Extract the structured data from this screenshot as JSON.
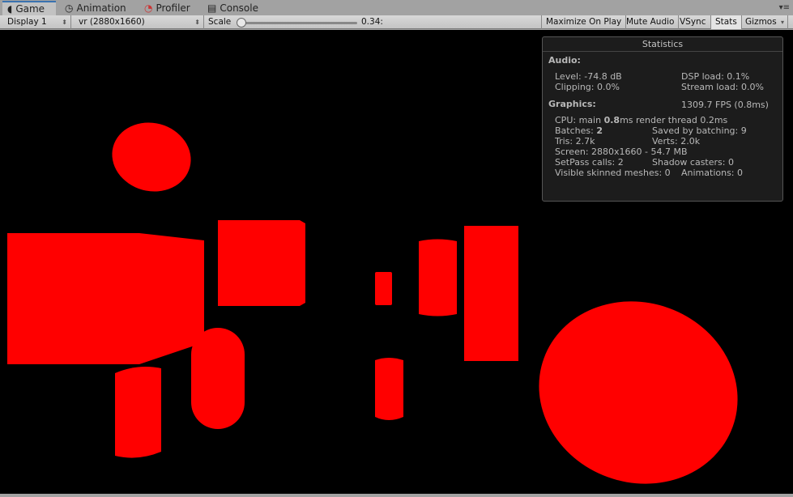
{
  "tabs": [
    {
      "label": "Game",
      "icon": "pacman-icon"
    },
    {
      "label": "Animation",
      "icon": "clock-icon"
    },
    {
      "label": "Profiler",
      "icon": "stopwatch-icon"
    },
    {
      "label": "Console",
      "icon": "document-icon"
    }
  ],
  "toolbar": {
    "display": "Display 1",
    "resolution": "vr (2880x1660)",
    "scale_label": "Scale",
    "scale_value": "0.34:",
    "scale_fraction": 0.02,
    "maximize": "Maximize On Play",
    "mute": "Mute Audio",
    "vsync": "VSync",
    "stats": "Stats",
    "gizmos": "Gizmos"
  },
  "stats": {
    "title": "Statistics",
    "audio_heading": "Audio:",
    "level": "Level: -74.8 dB",
    "dsp": "DSP load: 0.1%",
    "clipping": "Clipping: 0.0%",
    "stream": "Stream load: 0.0%",
    "graphics_heading": "Graphics:",
    "fps": "1309.7 FPS (0.8ms)",
    "cpu_prefix": "CPU: main ",
    "cpu_main": "0.8",
    "cpu_suffix": "ms  render thread 0.2ms",
    "batches_prefix": "Batches: ",
    "batches": "2",
    "saved": "Saved by batching: 9",
    "tris": "Tris: 2.7k",
    "verts": "Verts: 2.0k",
    "screen": "Screen: 2880x1660 - 54.7 MB",
    "setpass": "SetPass calls: 2",
    "shadow": "Shadow casters: 0",
    "skinned": "Visible skinned meshes: 0",
    "animations": "Animations: 0"
  },
  "colors": {
    "object": "#ff0000",
    "accent": "#3a72b0"
  }
}
